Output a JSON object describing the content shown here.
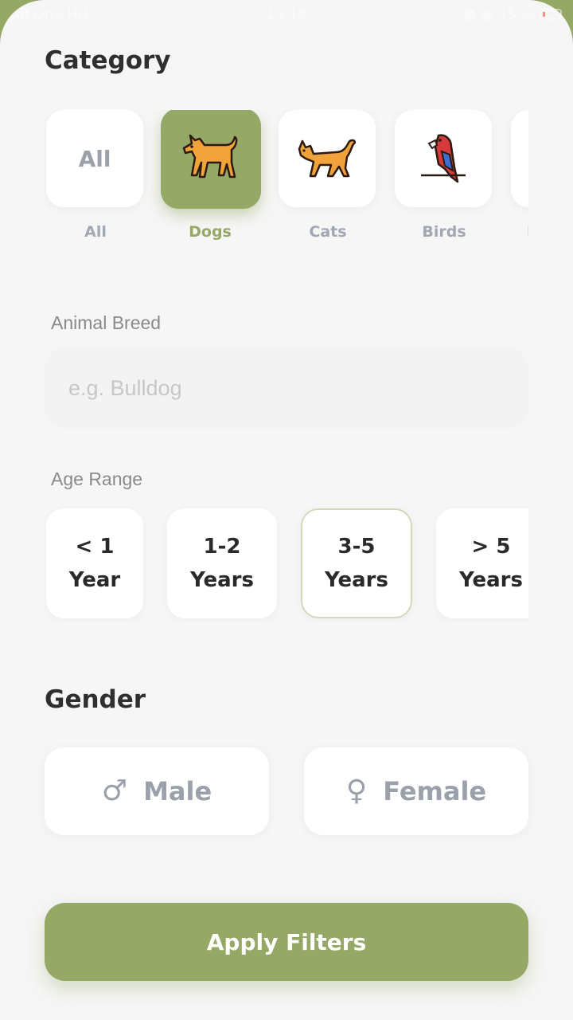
{
  "status_bar": {
    "carrier": "One HU",
    "time": "13:19",
    "battery": "15 %"
  },
  "category": {
    "title": "Category",
    "items": [
      {
        "label": "All",
        "tile_text": "All",
        "icon": "all-text",
        "selected": false
      },
      {
        "label": "Dogs",
        "icon": "dog-icon",
        "selected": true
      },
      {
        "label": "Cats",
        "icon": "cat-icon",
        "selected": false
      },
      {
        "label": "Birds",
        "icon": "parrot-icon",
        "selected": false
      },
      {
        "label": "I",
        "icon": "partial-icon",
        "selected": false
      }
    ]
  },
  "breed": {
    "label": "Animal Breed",
    "placeholder": "e.g. Bulldog",
    "value": ""
  },
  "age": {
    "label": "Age Range",
    "options": [
      {
        "line1": "< 1",
        "line2": "Year",
        "selected": false
      },
      {
        "line1": "1-2",
        "line2": "Years",
        "selected": false
      },
      {
        "line1": "3-5",
        "line2": "Years",
        "selected": true
      },
      {
        "line1": "> 5",
        "line2": "Years",
        "selected": false
      }
    ]
  },
  "gender": {
    "title": "Gender",
    "options": [
      {
        "label": "Male",
        "symbol": "♂",
        "icon": "male-icon"
      },
      {
        "label": "Female",
        "symbol": "♀",
        "icon": "female-icon"
      }
    ]
  },
  "apply_label": "Apply Filters",
  "colors": {
    "accent": "#95a866",
    "background": "#f6f6f6",
    "muted_text": "#9aa1ab",
    "dark_text": "#2a2a2a",
    "selected_border": "#d5d8b8"
  }
}
